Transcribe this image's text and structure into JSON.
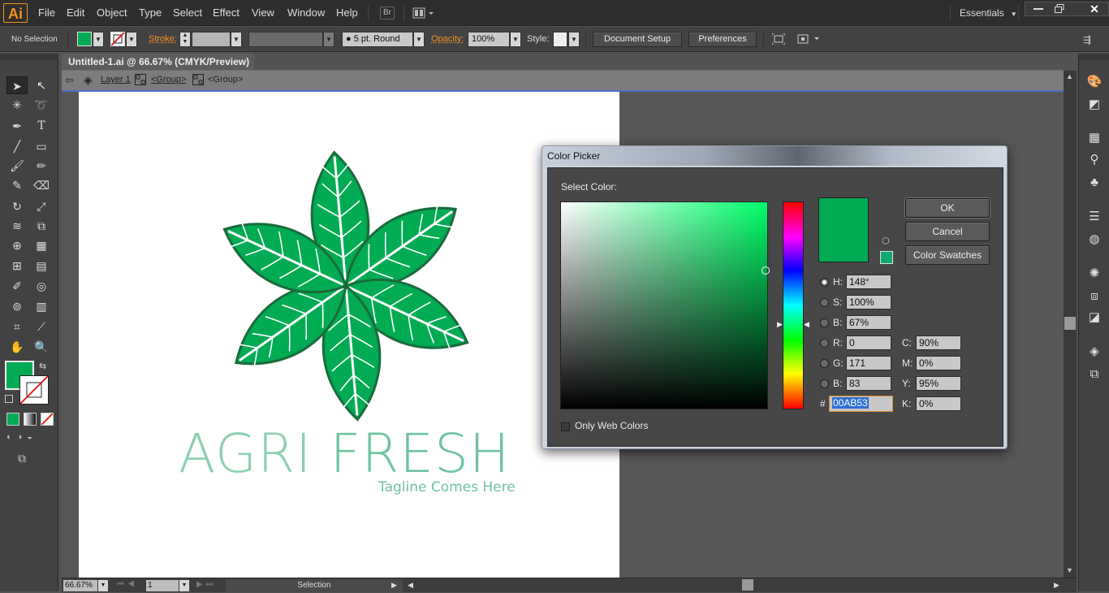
{
  "app": {
    "logo": "Ai",
    "bridge_icon": "Br",
    "workspace": "Essentials"
  },
  "menu": [
    "File",
    "Edit",
    "Object",
    "Type",
    "Select",
    "Effect",
    "View",
    "Window",
    "Help"
  ],
  "control": {
    "selection_state": "No Selection",
    "fill_color": "#00AB53",
    "stroke_label": "Stroke:",
    "brush_value": "5 pt. Round",
    "opacity_label": "Opacity:",
    "opacity_value": "100%",
    "style_label": "Style:",
    "doc_setup_label": "Document Setup",
    "preferences_label": "Preferences"
  },
  "document": {
    "tab_title": "Untitled-1.ai @ 66.67% (CMYK/Preview)",
    "tab_close": "×",
    "crumbs": [
      "Layer 1",
      "<Group>",
      "<Group>"
    ],
    "zoom": "66.67%",
    "artboard_num": "1",
    "status_tool": "Selection"
  },
  "artwork": {
    "title_part1": "AGRI ",
    "title_part2": "FRESH",
    "tagline": "Tagline Comes Here",
    "title_color1": "#8ccfb0",
    "title_color2": "#6fc3a0",
    "leaf_fill": "#00AB53",
    "leaf_stroke": "#1a6b3c"
  },
  "tools": {
    "fill_swatch": "#00AB53"
  },
  "color_picker": {
    "title": "Color Picker",
    "select_label": "Select Color:",
    "ok_label": "OK",
    "cancel_label": "Cancel",
    "swatches_label": "Color Swatches",
    "only_web_label": "Only Web Colors",
    "current_color": "#00AB53",
    "fields": {
      "H": {
        "label": "H:",
        "value": "148°"
      },
      "S": {
        "label": "S:",
        "value": "100%"
      },
      "Bv": {
        "label": "B:",
        "value": "67%"
      },
      "R": {
        "label": "R:",
        "value": "0"
      },
      "G": {
        "label": "G:",
        "value": "171"
      },
      "Bc": {
        "label": "B:",
        "value": "83"
      },
      "C": {
        "label": "C:",
        "value": "90%"
      },
      "M": {
        "label": "M:",
        "value": "0%"
      },
      "Y": {
        "label": "Y:",
        "value": "95%"
      },
      "K": {
        "label": "K:",
        "value": "0%"
      }
    },
    "hex_label": "#",
    "hex_value": "00AB53"
  }
}
